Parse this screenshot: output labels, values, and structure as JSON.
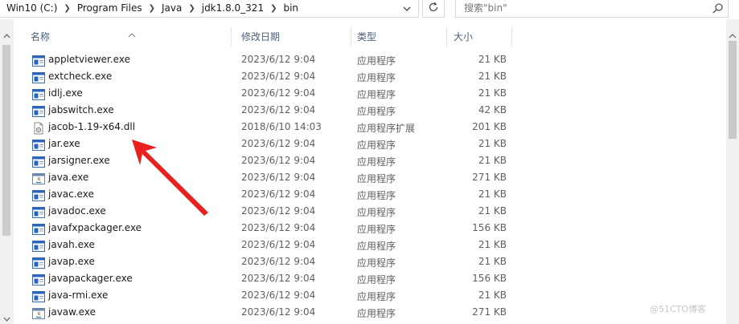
{
  "address_bar": {
    "crumbs": [
      "Win10 (C:)",
      "Program Files",
      "Java",
      "jdk1.8.0_321",
      "bin"
    ]
  },
  "search": {
    "placeholder": "搜索\"bin\""
  },
  "columns": {
    "name": "名称",
    "date": "修改日期",
    "type": "类型",
    "size": "大小"
  },
  "files": [
    {
      "name": "appletviewer.exe",
      "date": "2023/6/12 9:04",
      "type": "应用程序",
      "size": "21 KB",
      "icon": "exe-icon"
    },
    {
      "name": "extcheck.exe",
      "date": "2023/6/12 9:04",
      "type": "应用程序",
      "size": "21 KB",
      "icon": "exe-icon"
    },
    {
      "name": "idlj.exe",
      "date": "2023/6/12 9:04",
      "type": "应用程序",
      "size": "21 KB",
      "icon": "exe-icon"
    },
    {
      "name": "jabswitch.exe",
      "date": "2023/6/12 9:04",
      "type": "应用程序",
      "size": "42 KB",
      "icon": "exe-icon"
    },
    {
      "name": "jacob-1.19-x64.dll",
      "date": "2018/6/10 14:03",
      "type": "应用程序扩展",
      "size": "201 KB",
      "icon": "dll-icon"
    },
    {
      "name": "jar.exe",
      "date": "2023/6/12 9:04",
      "type": "应用程序",
      "size": "21 KB",
      "icon": "exe-icon"
    },
    {
      "name": "jarsigner.exe",
      "date": "2023/6/12 9:04",
      "type": "应用程序",
      "size": "21 KB",
      "icon": "exe-icon"
    },
    {
      "name": "java.exe",
      "date": "2023/6/12 9:04",
      "type": "应用程序",
      "size": "271 KB",
      "icon": "java-icon"
    },
    {
      "name": "javac.exe",
      "date": "2023/6/12 9:04",
      "type": "应用程序",
      "size": "21 KB",
      "icon": "exe-icon"
    },
    {
      "name": "javadoc.exe",
      "date": "2023/6/12 9:04",
      "type": "应用程序",
      "size": "21 KB",
      "icon": "exe-icon"
    },
    {
      "name": "javafxpackager.exe",
      "date": "2023/6/12 9:04",
      "type": "应用程序",
      "size": "156 KB",
      "icon": "exe-icon"
    },
    {
      "name": "javah.exe",
      "date": "2023/6/12 9:04",
      "type": "应用程序",
      "size": "21 KB",
      "icon": "exe-icon"
    },
    {
      "name": "javap.exe",
      "date": "2023/6/12 9:04",
      "type": "应用程序",
      "size": "21 KB",
      "icon": "exe-icon"
    },
    {
      "name": "javapackager.exe",
      "date": "2023/6/12 9:04",
      "type": "应用程序",
      "size": "156 KB",
      "icon": "exe-icon"
    },
    {
      "name": "java-rmi.exe",
      "date": "2023/6/12 9:04",
      "type": "应用程序",
      "size": "21 KB",
      "icon": "exe-icon"
    },
    {
      "name": "javaw.exe",
      "date": "2023/6/12 9:04",
      "type": "应用程序",
      "size": "271 KB",
      "icon": "java-icon"
    }
  ],
  "watermark": "@51CTO博客",
  "colors": {
    "arrow": "#e8211f",
    "header_text": "#4c607a",
    "exe_icon_blue": "#2a64b8"
  }
}
